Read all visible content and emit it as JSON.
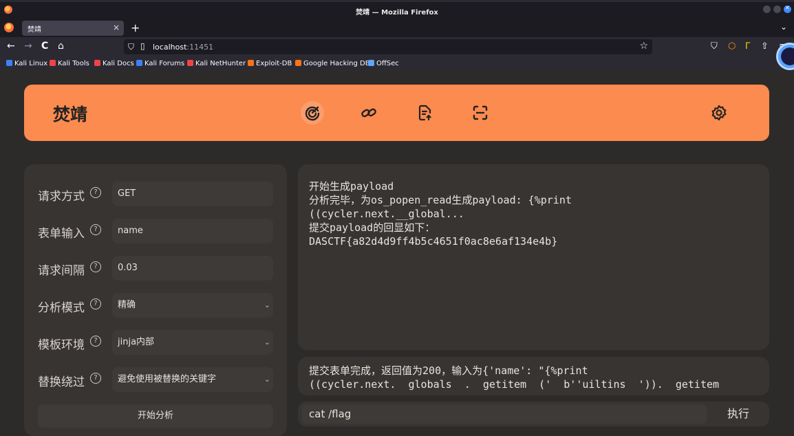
{
  "window": {
    "title": "焚靖 — Mozilla Firefox"
  },
  "tab": {
    "label": "焚靖",
    "close": "×"
  },
  "toolbar": {
    "new_tab": "+",
    "list_tabs": "⌄",
    "back": "←",
    "forward": "→",
    "reload": "C",
    "home": "⌂"
  },
  "urlbar": {
    "host": "localhost",
    "port": ":11451"
  },
  "bookmarks": [
    {
      "label": "Kali Linux",
      "color": "#3b82f6"
    },
    {
      "label": "Kali Tools",
      "color": "#ef4444"
    },
    {
      "label": "Kali Docs",
      "color": "#ef4444"
    },
    {
      "label": "Kali Forums",
      "color": "#3b82f6"
    },
    {
      "label": "Kali NetHunter",
      "color": "#ef4444"
    },
    {
      "label": "Exploit-DB",
      "color": "#f97316"
    },
    {
      "label": "Google Hacking DB",
      "color": "#f97316"
    },
    {
      "label": "OffSec",
      "color": "#60a5fa"
    }
  ],
  "app": {
    "title": "焚靖",
    "nav_icons": [
      "crack-icon",
      "link-icon",
      "file-upload-icon",
      "scan-icon"
    ],
    "settings_icon": "gear-icon",
    "accent_color": "#fb8b4f"
  },
  "form": {
    "method": {
      "label": "请求方式",
      "value": "GET"
    },
    "form_input": {
      "label": "表单输入",
      "value": "name"
    },
    "interval": {
      "label": "请求间隔",
      "value": "0.03"
    },
    "mode": {
      "label": "分析模式",
      "value": "精确"
    },
    "env": {
      "label": "模板环境",
      "value": "jinja内部"
    },
    "bypass": {
      "label": "替换绕过",
      "value": "避免使用被替换的关键字"
    },
    "start_button": "开始分析"
  },
  "output": {
    "lines": [
      "开始生成payload",
      "分析完毕，为os_popen_read生成payload: {%print",
      "((cycler.next.__global...",
      "提交payload的回显如下：",
      "DASCTF{a82d4d9ff4b5c4651f0ac8e6af134e4b}"
    ]
  },
  "log": {
    "lines": [
      "提交表单完成，返回值为200，输入为{'name': \"{%print",
      "((cycler.next.  globals  .  getitem  ('  b''uiltins  ')).  getitem"
    ]
  },
  "command": {
    "value": "cat /flag",
    "exec_label": "执行"
  }
}
